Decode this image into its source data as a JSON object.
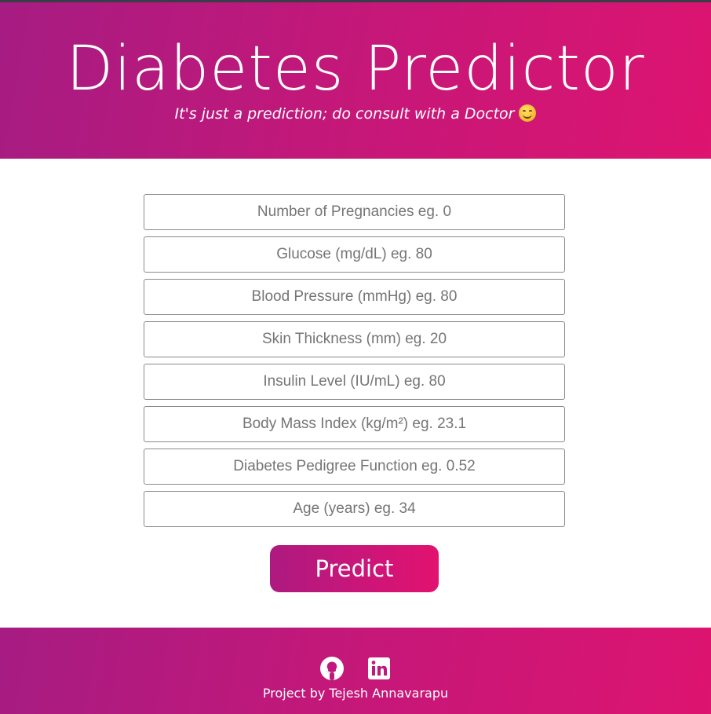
{
  "header": {
    "title": "Diabetes Predictor",
    "subtitle": "It's just a prediction; do consult with a Doctor",
    "emoji": "smiling-face-icon"
  },
  "form": {
    "fields": [
      {
        "placeholder": "Number of Pregnancies eg. 0",
        "value": ""
      },
      {
        "placeholder": "Glucose (mg/dL) eg. 80",
        "value": ""
      },
      {
        "placeholder": "Blood Pressure (mmHg) eg. 80",
        "value": ""
      },
      {
        "placeholder": "Skin Thickness (mm) eg. 20",
        "value": ""
      },
      {
        "placeholder": "Insulin Level (IU/mL) eg. 80",
        "value": ""
      },
      {
        "placeholder": "Body Mass Index (kg/m²) eg. 23.1",
        "value": ""
      },
      {
        "placeholder": "Diabetes Pedigree Function eg. 0.52",
        "value": ""
      },
      {
        "placeholder": "Age (years) eg. 34",
        "value": ""
      }
    ],
    "submit_label": "Predict"
  },
  "footer": {
    "icons": [
      "github-icon",
      "linkedin-icon"
    ],
    "credit": "Project by Tejesh Annavarapu"
  },
  "colors": {
    "gradient_start": "#a61c82",
    "gradient_end": "#dd1470",
    "text_on_brand": "#ffffff",
    "field_border": "#8a8a8a",
    "placeholder": "#757575"
  }
}
